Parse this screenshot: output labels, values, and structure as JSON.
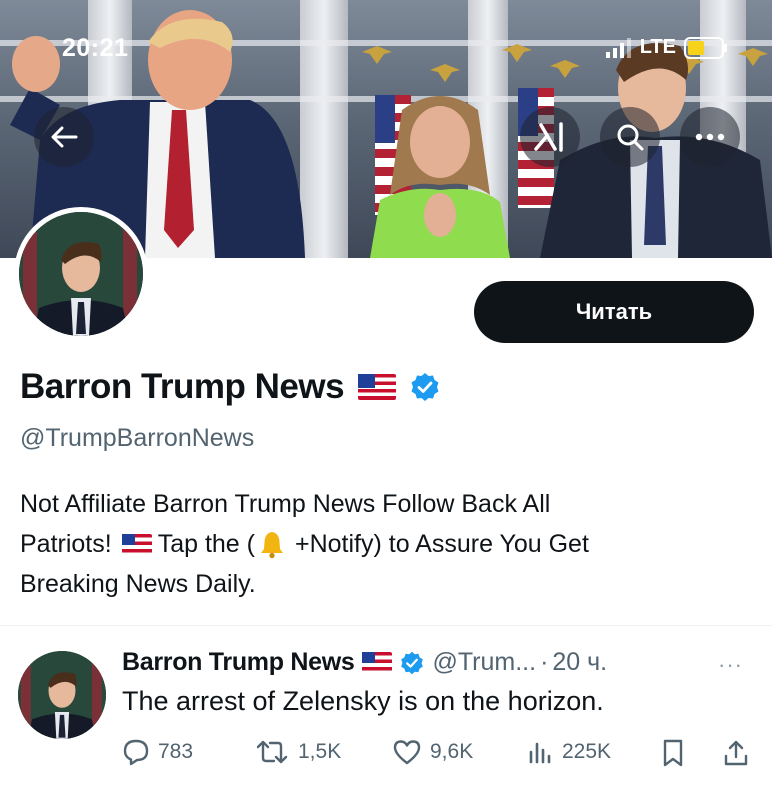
{
  "status_bar": {
    "time": "20:21",
    "network": "LTE"
  },
  "banner": {
    "buttons": [
      "back-icon",
      "grok-icon",
      "search-icon",
      "more-icon"
    ]
  },
  "profile": {
    "follow_label": "Читать",
    "display_name": "Barron Trump News",
    "handle": "@TrumpBarronNews",
    "bio_line1": "Not Affiliate Barron Trump News Follow Back All",
    "bio_line2a": "Patriots!",
    "bio_line2b": "Tap the (",
    "bio_line2c": "+Notify) to Assure You Get",
    "bio_line3": "Breaking News Daily.",
    "verified": true
  },
  "tweet": {
    "author": "Barron Trump News",
    "handle": "@Trum...",
    "separator": "·",
    "time": "20 ч.",
    "more": "···",
    "text": "The arrest of Zelensky is on the horizon.",
    "replies": "783",
    "retweets": "1,5K",
    "likes": "9,6K",
    "views": "225K"
  },
  "colors": {
    "accent": "#1d9bf0",
    "text": "#0f1419",
    "secondary": "#536471",
    "button": "#0f1419"
  }
}
